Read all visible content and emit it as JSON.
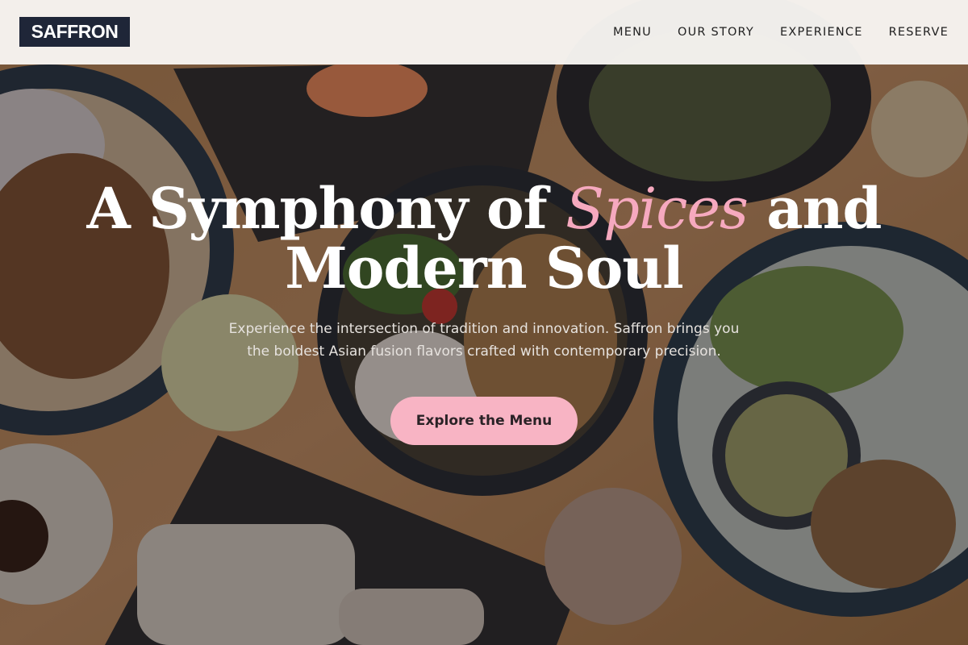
{
  "header": {
    "logo": "SAFFRON",
    "nav": [
      "MENU",
      "OUR STORY",
      "EXPERIENCE",
      "RESERVE"
    ]
  },
  "hero": {
    "title_part1": "A Symphony of ",
    "title_accent": "Spices",
    "title_part2": " and",
    "title_line2": "Modern Soul",
    "subtitle": "Experience the intersection of tradition and innovation. Saffron brings you the boldest Asian fusion flavors crafted with contemporary precision.",
    "cta_label": "Explore the Menu"
  },
  "colors": {
    "header_bg": "#f8f6f3",
    "logo_bg": "#1f2638",
    "accent_pink": "#f6a9bf",
    "cta_bg": "#f8b4c4"
  }
}
